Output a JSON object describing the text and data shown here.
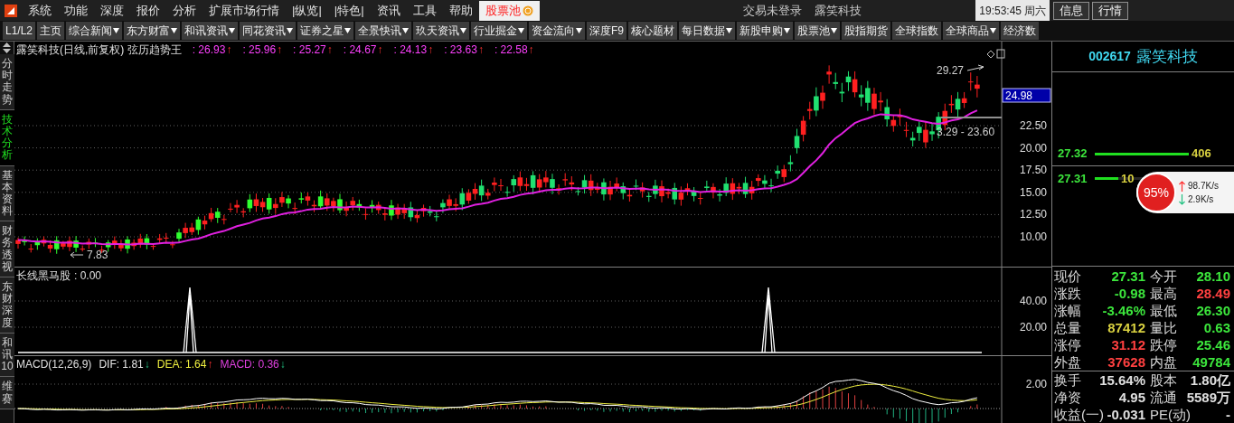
{
  "menu_bar": {
    "items": [
      {
        "label": "系统",
        "selected": false
      },
      {
        "label": "功能",
        "selected": false
      },
      {
        "label": "深度",
        "selected": false
      },
      {
        "label": "报价",
        "selected": false
      },
      {
        "label": "分析",
        "selected": false
      },
      {
        "label": "扩展市场行情",
        "selected": false
      },
      {
        "label": "|纵览|",
        "selected": false
      },
      {
        "label": "|特色|",
        "selected": false
      },
      {
        "label": "资讯",
        "selected": false
      },
      {
        "label": "工具",
        "selected": false
      },
      {
        "label": "帮助",
        "selected": false
      },
      {
        "label": "股票池",
        "selected": true
      }
    ],
    "status": "交易未登录",
    "stock_name": "露笑科技",
    "clock": "19:53:45",
    "weekday": "周六",
    "buttons": [
      "信息",
      "行情"
    ]
  },
  "toolbar": [
    {
      "label": "L1/L2",
      "dropdown": false
    },
    {
      "label": "主页",
      "dropdown": false
    },
    {
      "label": "综合新闻",
      "dropdown": true
    },
    {
      "label": "东方财富",
      "dropdown": true
    },
    {
      "label": "和讯资讯",
      "dropdown": true
    },
    {
      "label": "同花资讯",
      "dropdown": true
    },
    {
      "label": "证券之星",
      "dropdown": true
    },
    {
      "label": "全景快讯",
      "dropdown": true
    },
    {
      "label": "玖天资讯",
      "dropdown": true
    },
    {
      "label": "行业掘金",
      "dropdown": true
    },
    {
      "label": "资金流向",
      "dropdown": true
    },
    {
      "label": "深度F9",
      "dropdown": false
    },
    {
      "label": "核心题材",
      "dropdown": false
    },
    {
      "label": "每日数据",
      "dropdown": true
    },
    {
      "label": "新股申购",
      "dropdown": true
    },
    {
      "label": "股票池",
      "dropdown": true
    },
    {
      "label": "股指期货",
      "dropdown": false
    },
    {
      "label": "全球指数",
      "dropdown": false
    },
    {
      "label": "全球商品",
      "dropdown": true
    },
    {
      "label": "经济数",
      "dropdown": false
    }
  ],
  "side_tabs": [
    {
      "label": "分时走势",
      "selected": false
    },
    {
      "label": "技术分析",
      "selected": true
    },
    {
      "label": "基本资料",
      "selected": false
    },
    {
      "label": "财务透视",
      "selected": false
    },
    {
      "label": "东财深度",
      "selected": false
    },
    {
      "label": "和讯10",
      "selected": false
    },
    {
      "label": "维赛",
      "selected": false
    }
  ],
  "price_chart": {
    "title": "露笑科技(日线,前复权) 弦历趋势王",
    "values": [
      {
        "text": ": 26.93",
        "arrow": "↑",
        "rising": true
      },
      {
        "text": ": 25.96",
        "arrow": "↑",
        "rising": true
      },
      {
        "text": ": 25.27",
        "arrow": "↑",
        "rising": true
      },
      {
        "text": ": 24.67",
        "arrow": "↑",
        "rising": true
      },
      {
        "text": ": 24.13",
        "arrow": "↑",
        "rising": true
      },
      {
        "text": ": 23.63",
        "arrow": "↑",
        "rising": true
      },
      {
        "text": ": 22.58",
        "arrow": "↑",
        "rising": true
      }
    ],
    "high_label": "29.27",
    "range_label": "3.29 - 23.60",
    "low_label": "7.83",
    "current_price": "24.98",
    "axis_labels": [
      "22.50",
      "20.00",
      "17.50",
      "15.00",
      "12.50",
      "10.00"
    ]
  },
  "indicator_chart": {
    "title": "长线黑马股",
    "value": ": 0.00",
    "axis_labels": [
      "40.00",
      "20.00"
    ]
  },
  "macd_chart": {
    "title": "MACD(12,26,9)",
    "lines": [
      {
        "kind": "dif",
        "text": "DIF: 1.81",
        "arrow": "↓",
        "rising": false
      },
      {
        "kind": "dea",
        "text": "DEA: 1.64",
        "arrow": "↑",
        "rising": true
      },
      {
        "kind": "macd",
        "text": "MACD: 0.36",
        "arrow": "↓",
        "rising": false
      }
    ],
    "axis_labels": [
      "2.00"
    ]
  },
  "quote_panel": {
    "code": "002617",
    "name": "露笑科技",
    "order_book": [
      {
        "price": "27.32",
        "volume": "406",
        "level": 1.0
      },
      {
        "price": "27.31",
        "volume": "10",
        "level": 0.25
      }
    ],
    "stats": [
      {
        "label": "现价",
        "value": "27.31",
        "color": "#3ce63c"
      },
      {
        "label": "今开",
        "value": "28.10",
        "color": "#3ce63c"
      },
      {
        "label": "涨跌",
        "value": "-0.98",
        "color": "#3ce63c"
      },
      {
        "label": "最高",
        "value": "28.49",
        "color": "#ff4040"
      },
      {
        "label": "涨幅",
        "value": "-3.46%",
        "color": "#3ce63c"
      },
      {
        "label": "最低",
        "value": "26.30",
        "color": "#3ce63c"
      },
      {
        "label": "总量",
        "value": "87412",
        "color": "#d8d040"
      },
      {
        "label": "量比",
        "value": "0.63",
        "color": "#3ce63c"
      },
      {
        "label": "涨停",
        "value": "31.12",
        "color": "#ff4040"
      },
      {
        "label": "跌停",
        "value": "25.46",
        "color": "#3ce63c"
      },
      {
        "label": "外盘",
        "value": "37628",
        "color": "#ff4040"
      },
      {
        "label": "内盘",
        "value": "49784",
        "color": "#3ce63c"
      }
    ],
    "stats_lower": [
      {
        "label": "换手",
        "value": "15.64%",
        "color": "#e0e0e0"
      },
      {
        "label": "股本",
        "value": "1.80亿",
        "color": "#e0e0e0"
      },
      {
        "label": "净资",
        "value": "4.95",
        "color": "#e0e0e0"
      },
      {
        "label": "流通",
        "value": "5589万",
        "color": "#e0e0e0"
      },
      {
        "label": "收益(一)",
        "value": "-0.031",
        "color": "#e0e0e0"
      },
      {
        "label": "PE(动)",
        "value": "-",
        "color": "#e0e0e0"
      }
    ]
  },
  "speed_widget": {
    "percent": "95%",
    "upload": "98.7K/s",
    "download": "2.9K/s"
  }
}
